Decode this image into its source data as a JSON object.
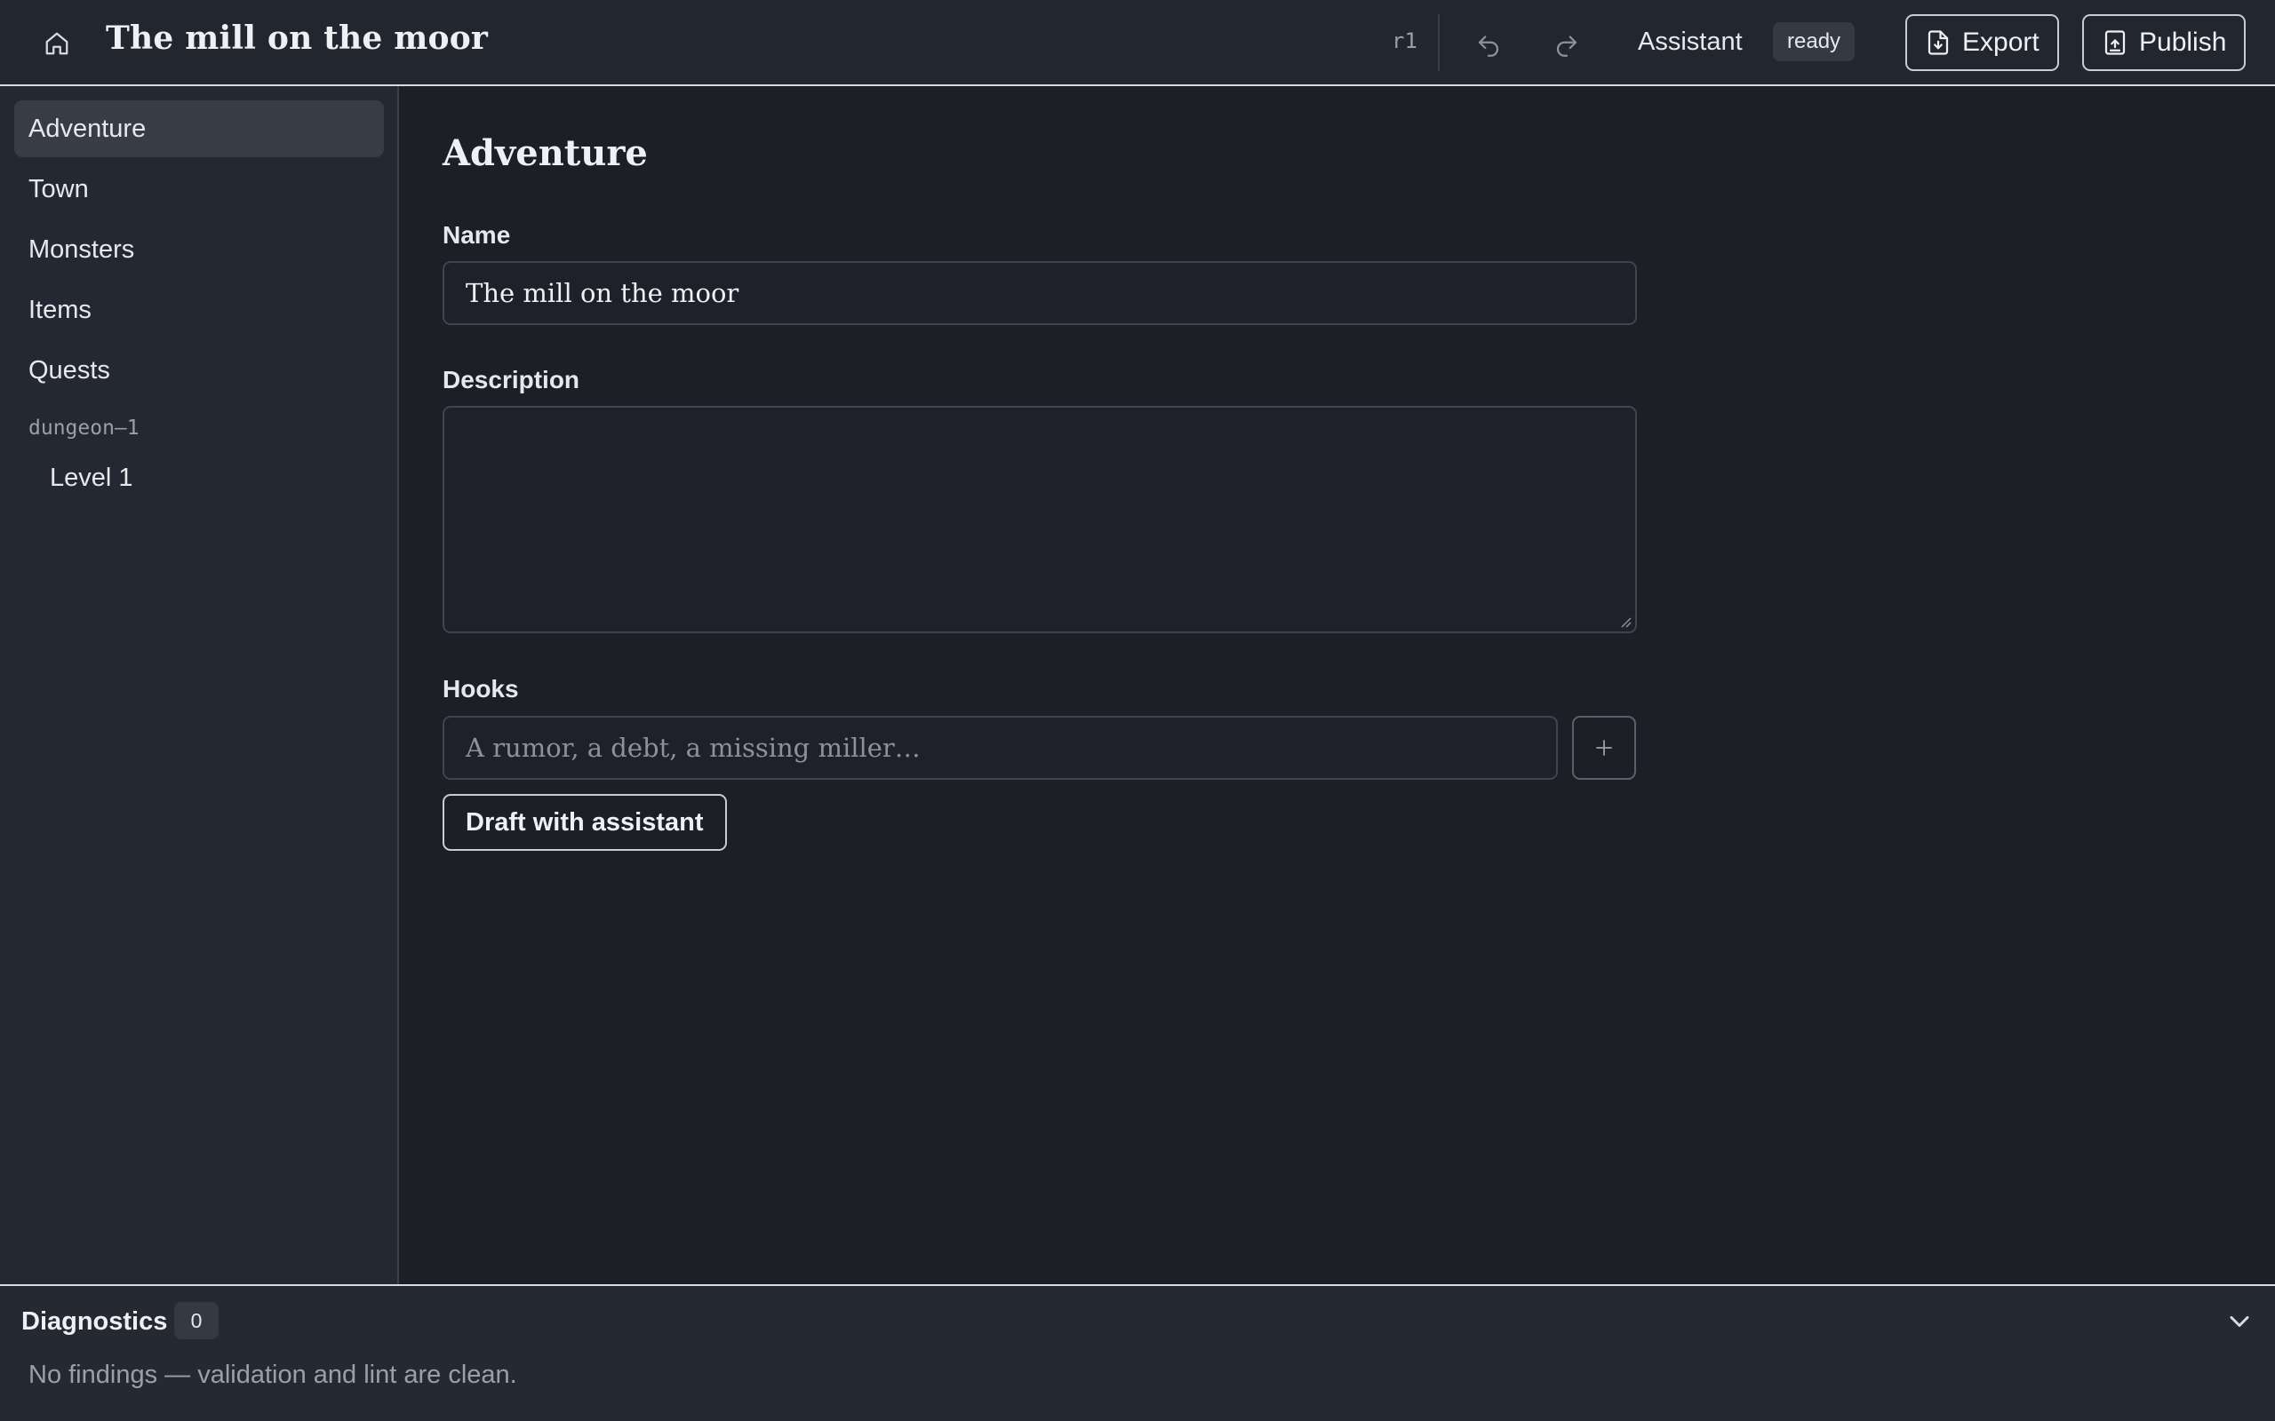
{
  "header": {
    "title": "The mill on the moor",
    "revision": "r1",
    "assistant_label": "Assistant",
    "assistant_status": "ready",
    "export_label": "Export",
    "publish_label": "Publish"
  },
  "sidebar": {
    "items": [
      {
        "label": "Adventure",
        "active": true
      },
      {
        "label": "Town"
      },
      {
        "label": "Monsters"
      },
      {
        "label": "Items"
      },
      {
        "label": "Quests"
      }
    ],
    "group_label": "dungeon–1",
    "sub_items": [
      {
        "label": "Level 1"
      }
    ]
  },
  "main": {
    "title": "Adventure",
    "name_label": "Name",
    "name_value": "The mill on the moor",
    "description_label": "Description",
    "description_value": "",
    "hooks_label": "Hooks",
    "hooks_placeholder": "A rumor, a debt, a missing miller…",
    "draft_button": "Draft with assistant"
  },
  "diagnostics": {
    "title": "Diagnostics",
    "count": "0",
    "message": "No findings — validation and lint are clean."
  },
  "icons": {
    "home": "home-icon",
    "undo": "undo-icon",
    "redo": "redo-icon",
    "export": "file-download-icon",
    "publish": "file-upload-icon",
    "add": "plus-icon",
    "collapse": "chevron-down-icon"
  }
}
